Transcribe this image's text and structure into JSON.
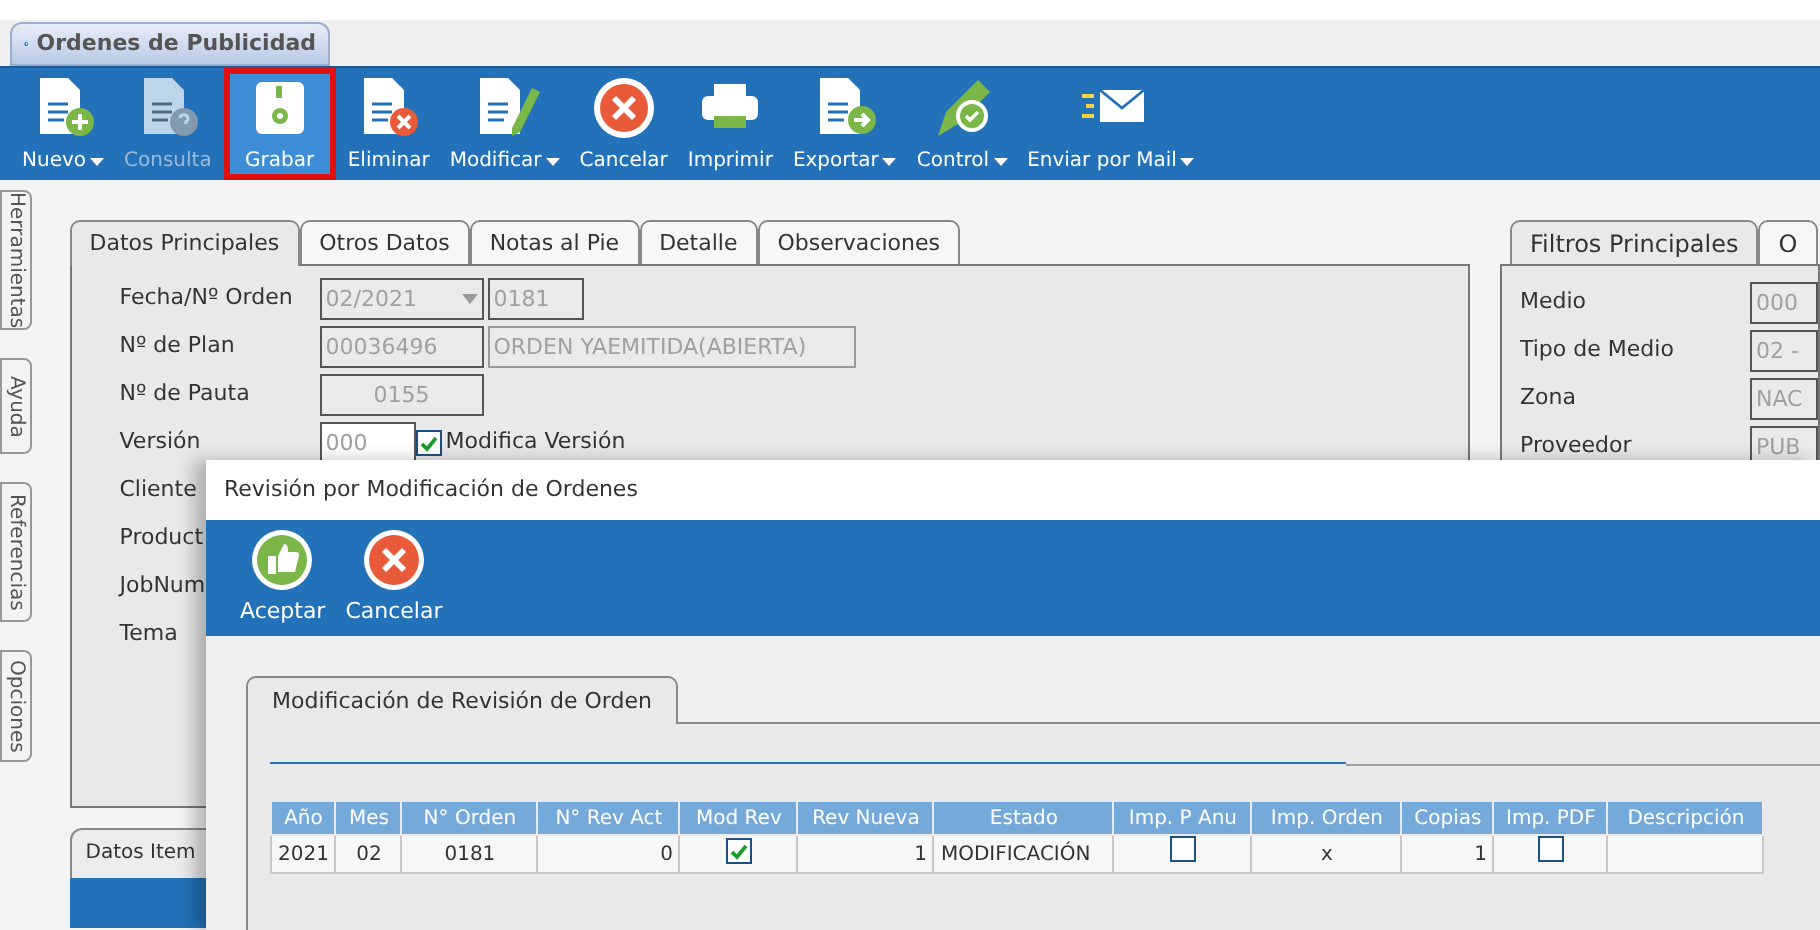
{
  "window_tab": {
    "title": "Ordenes de Publicidad"
  },
  "toolbar": [
    {
      "label": "Nuevo",
      "dropdown": true,
      "disabled": false,
      "selected": false
    },
    {
      "label": "Consulta",
      "dropdown": false,
      "disabled": true,
      "selected": false
    },
    {
      "label": "Grabar",
      "dropdown": false,
      "disabled": false,
      "selected": true
    },
    {
      "label": "Eliminar",
      "dropdown": false,
      "disabled": false,
      "selected": false
    },
    {
      "label": "Modificar",
      "dropdown": true,
      "disabled": false,
      "selected": false
    },
    {
      "label": "Cancelar",
      "dropdown": false,
      "disabled": false,
      "selected": false
    },
    {
      "label": "Imprimir",
      "dropdown": false,
      "disabled": false,
      "selected": false
    },
    {
      "label": "Exportar",
      "dropdown": true,
      "disabled": false,
      "selected": false
    },
    {
      "label": "Control",
      "dropdown": true,
      "disabled": false,
      "selected": false
    },
    {
      "label": "Enviar por Mail",
      "dropdown": true,
      "disabled": false,
      "selected": false
    }
  ],
  "side_tabs": [
    "Herramientas",
    "Ayuda",
    "Referencias",
    "Opciones"
  ],
  "main_tabs": [
    {
      "label": "Datos Principales",
      "selected": true
    },
    {
      "label": "Otros Datos",
      "selected": false
    },
    {
      "label": "Notas al Pie",
      "selected": false
    },
    {
      "label": "Detalle",
      "selected": false
    },
    {
      "label": "Observaciones",
      "selected": false
    }
  ],
  "form": {
    "fecha_label": "Fecha/Nº Orden",
    "fecha_value": "02/2021",
    "orden_value": "0181",
    "plan_label": "Nº de Plan",
    "plan_value": "00036496",
    "plan_status": "ORDEN YAEMITIDA(ABIERTA)",
    "pauta_label": "Nº de Pauta",
    "pauta_value": "0155",
    "version_label": "Versión",
    "version_value": "000",
    "modifica_version": {
      "label": "Modifica Versión",
      "checked": true
    },
    "other_labels": [
      "Cliente",
      "Product",
      "JobNum",
      "Tema"
    ]
  },
  "items_panel": {
    "title": "Datos Item"
  },
  "filters": {
    "tabs": [
      {
        "label": "Filtros Principales",
        "selected": true
      },
      {
        "label": "O",
        "selected": false
      }
    ],
    "fields": [
      {
        "label": "Medio",
        "value": "000"
      },
      {
        "label": "Tipo de Medio",
        "value": "02 -"
      },
      {
        "label": "Zona",
        "value": "NAC"
      },
      {
        "label": "Proveedor",
        "value": "PUB"
      }
    ]
  },
  "dialog": {
    "title": "Revisión por Modificación de Ordenes",
    "toolbar": [
      "Aceptar",
      "Cancelar"
    ],
    "tab": "Modificación de Revisión de Orden",
    "table": {
      "columns": [
        "Año",
        "Mes",
        "N° Orden",
        "N° Rev Act",
        "Mod Rev",
        "Rev Nueva",
        "Estado",
        "Imp. P Anu",
        "Imp. Orden",
        "Copias",
        "Imp. PDF",
        "Descripción"
      ],
      "rows": [
        [
          {
            "kind": "text",
            "text": "2021"
          },
          {
            "kind": "text",
            "text": "02"
          },
          {
            "kind": "text",
            "text": "0181"
          },
          {
            "kind": "text",
            "text": "0"
          },
          {
            "kind": "check",
            "checked": true
          },
          {
            "kind": "text",
            "text": "1"
          },
          {
            "kind": "text",
            "text": "MODIFICACIÓN"
          },
          {
            "kind": "check",
            "checked": false
          },
          {
            "kind": "text",
            "text": "x"
          },
          {
            "kind": "text",
            "text": "1"
          },
          {
            "kind": "check",
            "checked": false
          },
          {
            "kind": "empty"
          }
        ]
      ]
    }
  }
}
